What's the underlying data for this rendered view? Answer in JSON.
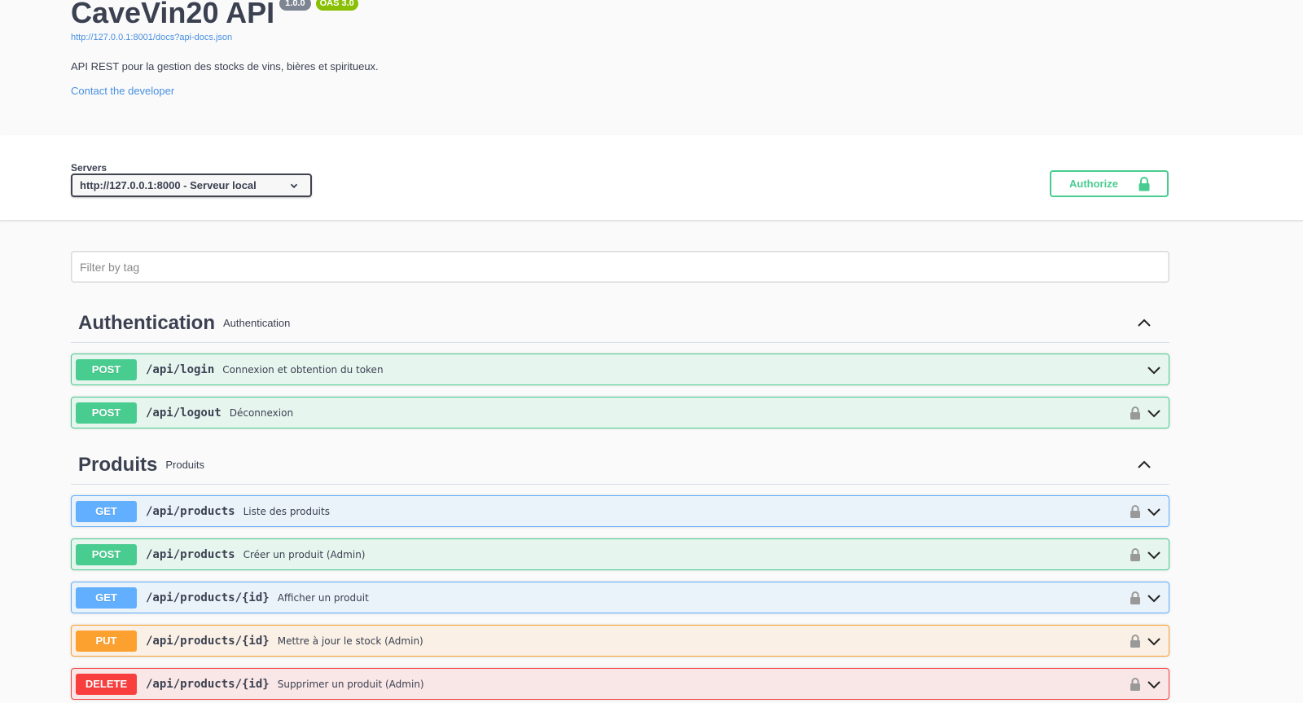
{
  "info": {
    "title": "CaveVin20 API",
    "version": "1.0.0",
    "oas": "OAS 3.0",
    "spec_url": "http://127.0.0.1:8001/docs?api-docs.json",
    "description": "API REST pour la gestion des stocks de vins, bières et spiritueux.",
    "contact": "Contact the developer"
  },
  "servers": {
    "label": "Servers",
    "selected": "http://127.0.0.1:8000 - Serveur local"
  },
  "authorize": {
    "label": "Authorize"
  },
  "filter": {
    "placeholder": "Filter by tag"
  },
  "tags": [
    {
      "name": "Authentication",
      "description": "Authentication",
      "operations": [
        {
          "method": "POST",
          "path": "/api/login",
          "summary": "Connexion et obtention du token",
          "locked": false
        },
        {
          "method": "POST",
          "path": "/api/logout",
          "summary": "Déconnexion",
          "locked": true
        }
      ]
    },
    {
      "name": "Produits",
      "description": "Produits",
      "operations": [
        {
          "method": "GET",
          "path": "/api/products",
          "summary": "Liste des produits",
          "locked": true
        },
        {
          "method": "POST",
          "path": "/api/products",
          "summary": "Créer un produit (Admin)",
          "locked": true
        },
        {
          "method": "GET",
          "path": "/api/products/{id}",
          "summary": "Afficher un produit",
          "locked": true
        },
        {
          "method": "PUT",
          "path": "/api/products/{id}",
          "summary": "Mettre à jour le stock (Admin)",
          "locked": true
        },
        {
          "method": "DELETE",
          "path": "/api/products/{id}",
          "summary": "Supprimer un produit (Admin)",
          "locked": true
        }
      ]
    }
  ],
  "colors": {
    "post": "#49cc90",
    "get": "#61affe",
    "put": "#fca130",
    "delete": "#f93e3e",
    "link": "#4990e2"
  }
}
